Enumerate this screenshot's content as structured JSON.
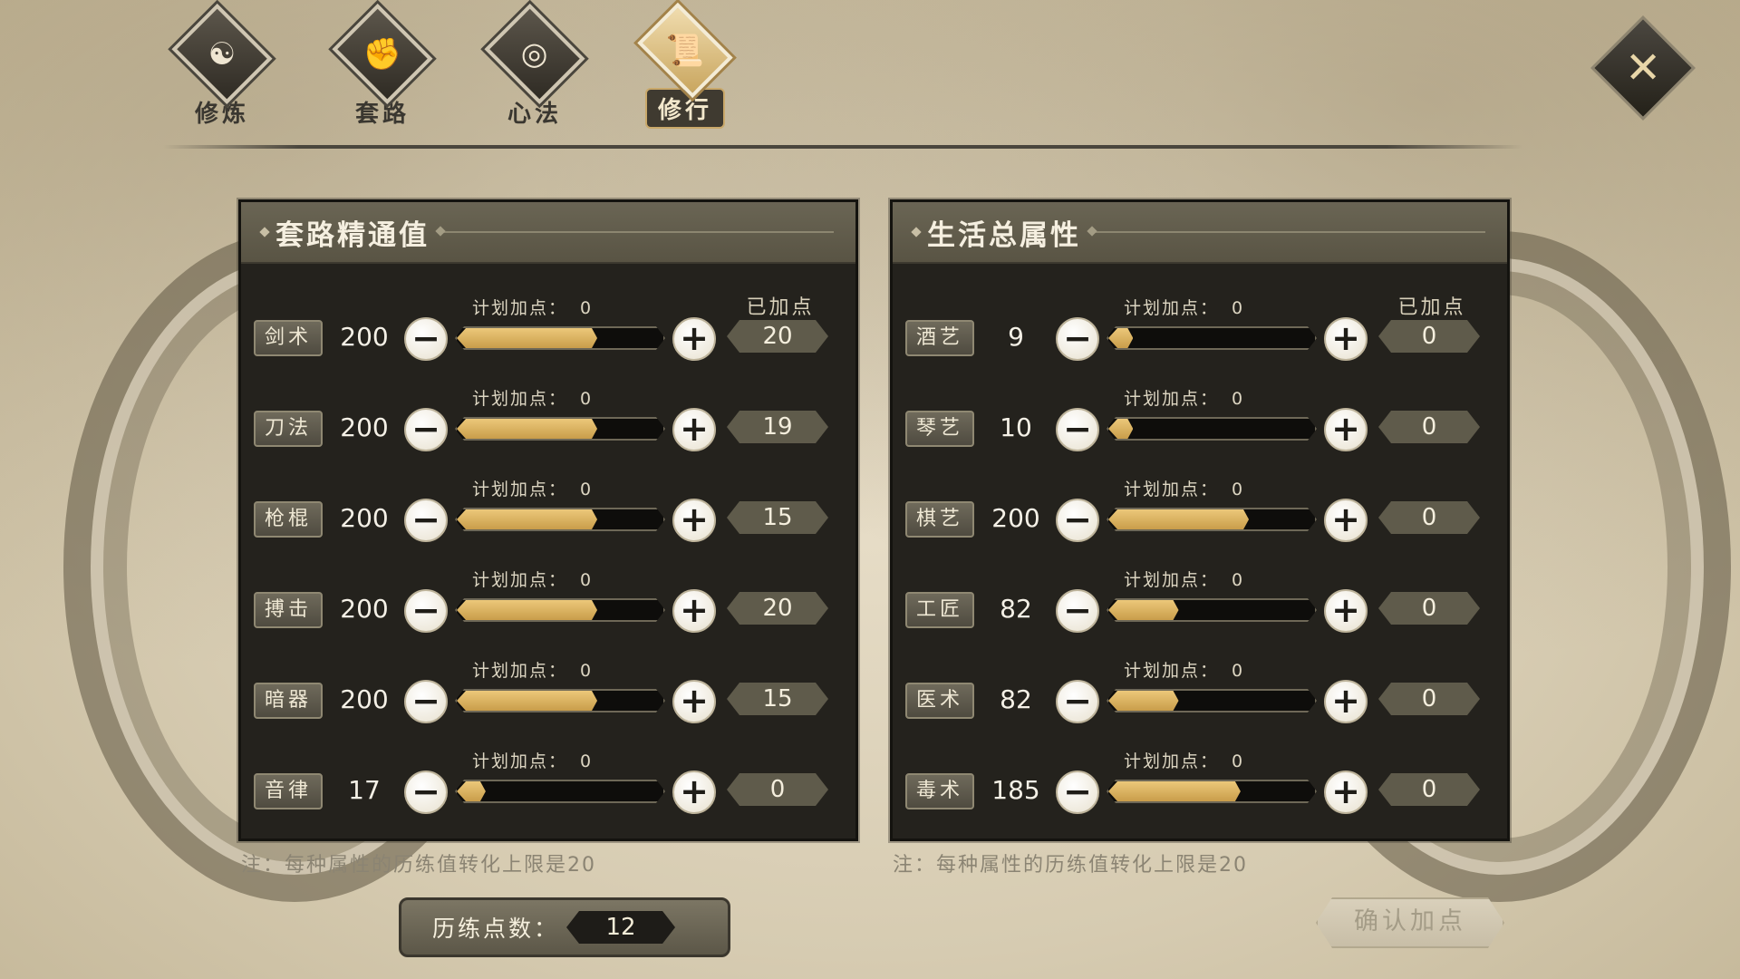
{
  "tabs": [
    {
      "label": "修炼",
      "icon": "flame-yin-yang-icon",
      "glyph": "☯",
      "active": false
    },
    {
      "label": "套路",
      "icon": "fist-icon",
      "glyph": "✊",
      "active": false
    },
    {
      "label": "心法",
      "icon": "swirl-icon",
      "glyph": "◎",
      "active": false
    },
    {
      "label": "修行",
      "icon": "scroll-icon",
      "glyph": "📜",
      "active": true
    }
  ],
  "close": {
    "icon": "close-icon",
    "glyph": "✕"
  },
  "left_panel": {
    "title": "套路精通值",
    "added_header": "已加点",
    "plan_label": "计划加点：",
    "rows": [
      {
        "name": "剑术",
        "value": "200",
        "plan": "0",
        "added": "20",
        "fill": 0.68
      },
      {
        "name": "刀法",
        "value": "200",
        "plan": "0",
        "added": "19",
        "fill": 0.68
      },
      {
        "name": "枪棍",
        "value": "200",
        "plan": "0",
        "added": "15",
        "fill": 0.68
      },
      {
        "name": "搏击",
        "value": "200",
        "plan": "0",
        "added": "20",
        "fill": 0.68
      },
      {
        "name": "暗器",
        "value": "200",
        "plan": "0",
        "added": "15",
        "fill": 0.68
      },
      {
        "name": "音律",
        "value": "17",
        "plan": "0",
        "added": "0",
        "fill": 0.14
      }
    ],
    "note": "注：每种属性的历练值转化上限是20"
  },
  "right_panel": {
    "title": "生活总属性",
    "added_header": "已加点",
    "plan_label": "计划加点：",
    "rows": [
      {
        "name": "酒艺",
        "value": "9",
        "plan": "0",
        "added": "0",
        "fill": 0.12
      },
      {
        "name": "琴艺",
        "value": "10",
        "plan": "0",
        "added": "0",
        "fill": 0.12
      },
      {
        "name": "棋艺",
        "value": "200",
        "plan": "0",
        "added": "0",
        "fill": 0.68
      },
      {
        "name": "工匠",
        "value": "82",
        "plan": "0",
        "added": "0",
        "fill": 0.34
      },
      {
        "name": "医术",
        "value": "82",
        "plan": "0",
        "added": "0",
        "fill": 0.34
      },
      {
        "name": "毒术",
        "value": "185",
        "plan": "0",
        "added": "0",
        "fill": 0.64
      }
    ],
    "note": "注：每种属性的历练值转化上限是20"
  },
  "points": {
    "label": "历练点数：",
    "value": "12"
  },
  "confirm_label": "确认加点",
  "colors": {
    "bar_fill": "#e2bc6a",
    "panel_bg": "#24221d",
    "header_bg": "#625d4d"
  }
}
